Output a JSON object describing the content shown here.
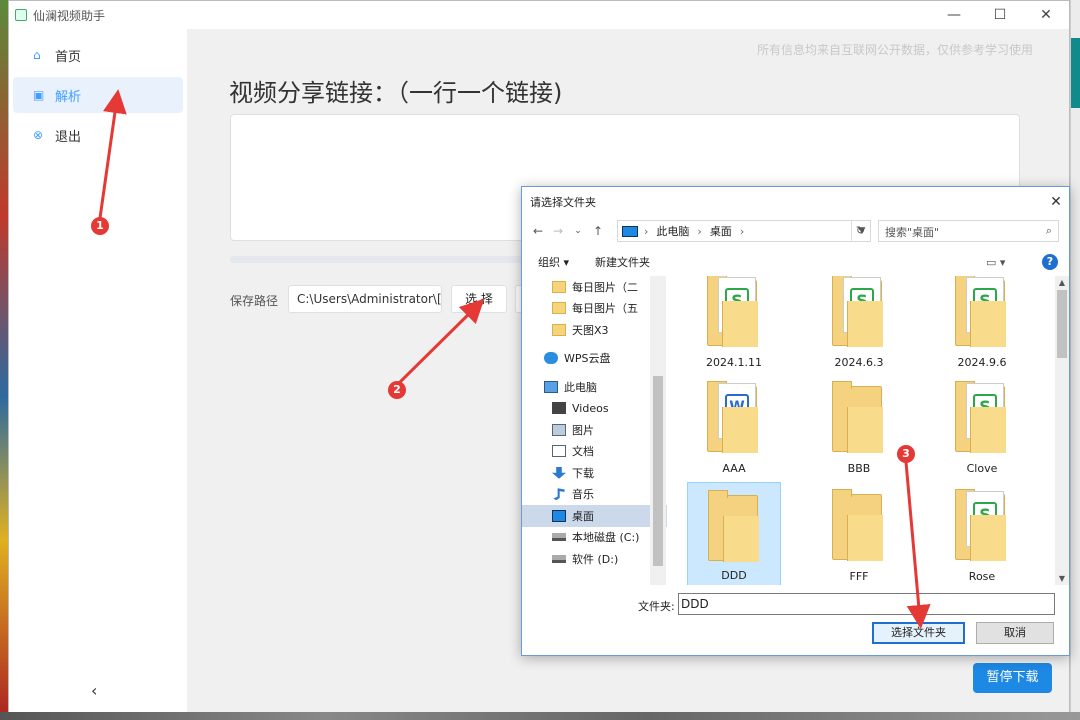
{
  "app": {
    "title": "仙澜视频助手",
    "controls": {
      "minimize": "—",
      "maximize": "☐",
      "close": "✕"
    }
  },
  "sidebar": {
    "items": [
      {
        "label": "首页",
        "icon": "home-icon"
      },
      {
        "label": "解析",
        "icon": "parse-icon"
      },
      {
        "label": "退出",
        "icon": "exit-icon"
      }
    ],
    "collapse": "‹"
  },
  "main": {
    "disclaimer": "所有信息均来自互联网公开数据，仅供参考学习使用",
    "title": "视频分享链接：（一行一个链接)",
    "save_label": "保存路径",
    "save_path": "C:\\Users\\Administrator\\[",
    "choose_label": "选 择",
    "pause_label": "暂停下载"
  },
  "dialog": {
    "title": "请选择文件夹",
    "breadcrumb": [
      "此电脑",
      "桌面"
    ],
    "search_placeholder": "搜索\"桌面\"",
    "organize": "组织 ▾",
    "new_folder": "新建文件夹",
    "tree": [
      {
        "label": "每日图片（二",
        "type": "folder"
      },
      {
        "label": "每日图片（五",
        "type": "folder"
      },
      {
        "label": "天图X3",
        "type": "folder"
      },
      {
        "label": "",
        "type": "spacer"
      },
      {
        "label": "WPS云盘",
        "type": "cloud"
      },
      {
        "label": "",
        "type": "spacer"
      },
      {
        "label": "此电脑",
        "type": "pc"
      },
      {
        "label": "Videos",
        "type": "vid"
      },
      {
        "label": "图片",
        "type": "img"
      },
      {
        "label": "文档",
        "type": "doc"
      },
      {
        "label": "下载",
        "type": "down"
      },
      {
        "label": "音乐",
        "type": "music"
      },
      {
        "label": "桌面",
        "type": "desk"
      },
      {
        "label": "本地磁盘 (C:)",
        "type": "drive"
      },
      {
        "label": "软件 (D:)",
        "type": "drive"
      }
    ],
    "files": [
      {
        "name": "2024.1.11",
        "kind": "wps-s"
      },
      {
        "name": "2024.6.3",
        "kind": "wps-s"
      },
      {
        "name": "2024.9.6",
        "kind": "wps-s"
      },
      {
        "name": "AAA",
        "kind": "wps-w"
      },
      {
        "name": "BBB",
        "kind": "folder"
      },
      {
        "name": "Clove",
        "kind": "wps-s"
      },
      {
        "name": "DDD",
        "kind": "folder"
      },
      {
        "name": "FFF",
        "kind": "folder"
      },
      {
        "name": "Rose",
        "kind": "wps-s"
      }
    ],
    "selected_file": "DDD",
    "folder_label": "文件夹:",
    "folder_value": "DDD",
    "ok_label": "选择文件夹",
    "cancel_label": "取消"
  },
  "annotations": [
    {
      "number": "1"
    },
    {
      "number": "2"
    },
    {
      "number": "3"
    }
  ],
  "colors": {
    "accent": "#1e88e5",
    "annotation": "#e53935",
    "selection": "#cce8ff"
  }
}
